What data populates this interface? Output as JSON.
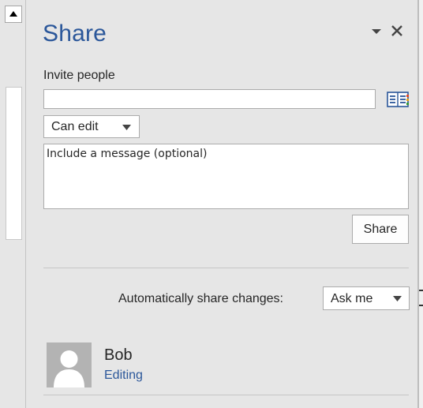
{
  "pane": {
    "title": "Share",
    "title_menu_icon": "chevron-down-icon",
    "close_icon": "close-icon"
  },
  "invite": {
    "label": "Invite people",
    "value": "",
    "address_book_icon": "address-book-icon"
  },
  "permission": {
    "selected": "Can edit"
  },
  "message": {
    "placeholder": "Include a message (optional)",
    "value": ""
  },
  "share_button": {
    "label": "Share"
  },
  "auto_share": {
    "label": "Automatically share changes:",
    "selected": "Ask me"
  },
  "people": [
    {
      "name": "Bob",
      "status": "Editing",
      "avatar_icon": "person-silhouette-icon"
    }
  ],
  "colors": {
    "accent": "#2b579a",
    "pane_background": "#e6e6e6",
    "avatar_background": "#b3b3b3"
  }
}
